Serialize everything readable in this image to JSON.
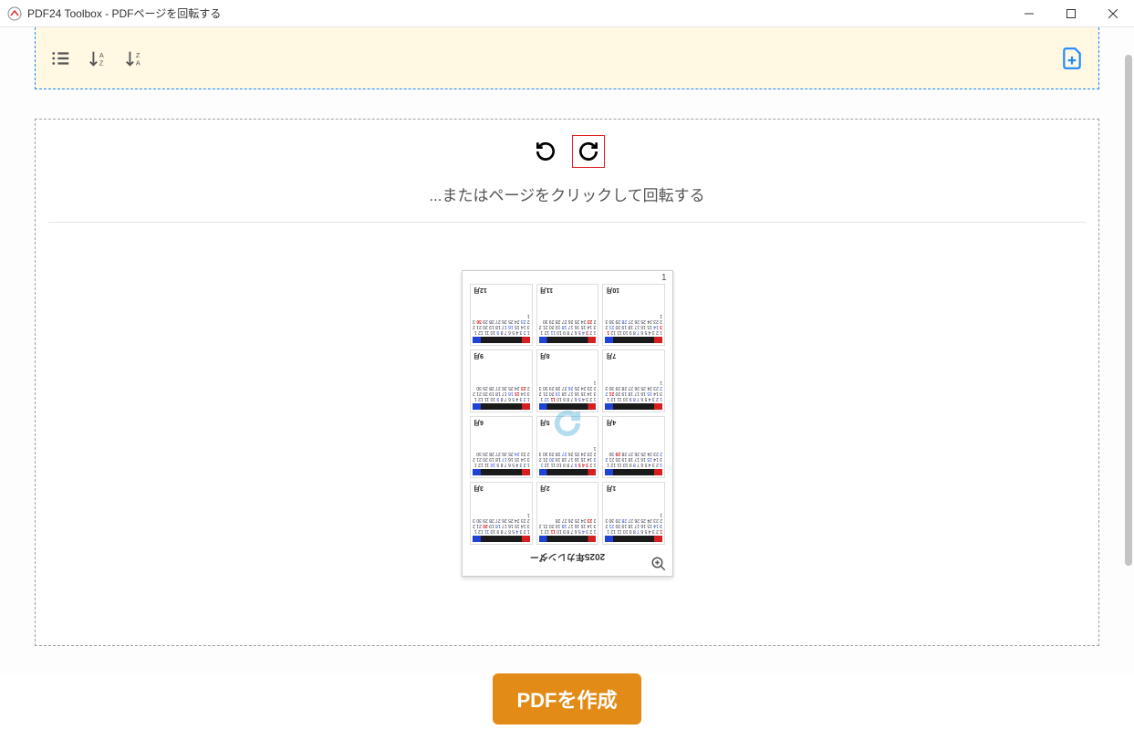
{
  "window": {
    "title": "PDF24 Toolbox - PDFページを回転する"
  },
  "toolbar": {
    "list_icon": "list-icon",
    "sort_az_icon": "sort-az-icon",
    "sort_za_icon": "sort-za-icon",
    "add_file_icon": "add-file-icon"
  },
  "rotate": {
    "ccw_icon": "rotate-ccw-icon",
    "cw_icon": "rotate-cw-icon",
    "hint": "...またはページをクリックして回転する"
  },
  "thumbnail": {
    "page_number": "1",
    "doc_title": "2025年カレンダー",
    "months": [
      "1月",
      "2月",
      "3月",
      "4月",
      "5月",
      "6月",
      "7月",
      "8月",
      "9月",
      "10月",
      "11月",
      "12月"
    ],
    "overlay_icon": "rotate-cw-icon",
    "zoom_icon": "zoom-in-icon"
  },
  "cta": {
    "label": "PDFを作成"
  }
}
